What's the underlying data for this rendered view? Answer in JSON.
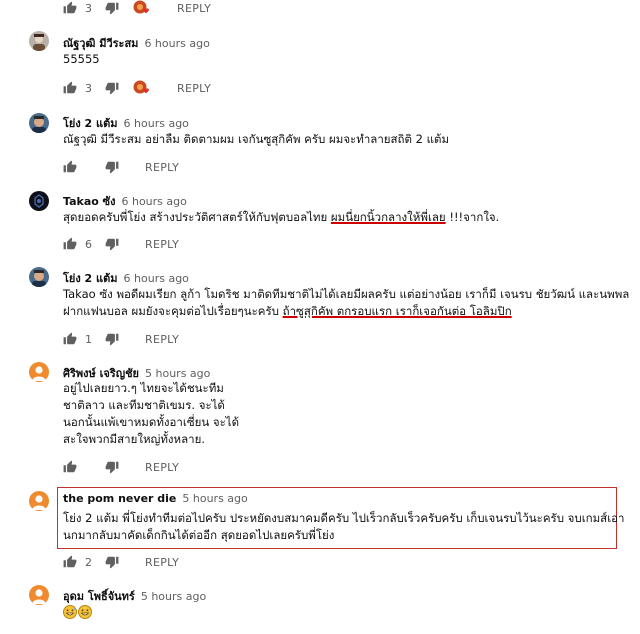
{
  "reply_label": "REPLY",
  "comments": [
    {
      "author": "",
      "time": "",
      "lines": [],
      "likes": "3",
      "creator_heart": true
    },
    {
      "author": "ณัฐวุฒิ มีวีระสม",
      "time": "6 hours ago",
      "lines": [
        "55555"
      ],
      "likes": "3",
      "creator_heart": true
    },
    {
      "author": "โย่ง 2 แต้ม",
      "time": "6 hours ago",
      "lines": [
        "ณัฐวุฒิ มีวีระสม อย่าลืม ติดตามผม เจกันซูสุกิคัพ ครับ ผมจะทำลายสถิติ 2 แต้ม"
      ],
      "likes": "",
      "creator_heart": false
    },
    {
      "author": "Takao ซัง",
      "time": "6 hours ago",
      "line_plain": "สุดยอดครับพี่โย่ง สร้างประวัติศาสตร์ให้กับฟุตบอลไทย ",
      "line_underlined": "ผมนี่ยกนิ้วกลางให้พี่เลย",
      "line_tail": " !!!จากใจ.",
      "likes": "6",
      "creator_heart": false
    },
    {
      "author": "โย่ง 2 แต้ม",
      "time": "6 hours ago",
      "line1": "Takao ซัง พอดีผมเรียก ลูก้า โมดริช มาติดทีมชาติไม่ได้เลยมีผลครับ แต่อย่างน้อย เราก็มี เจนรบ ชัยวัฒน์ และนพพล",
      "line2_plain": "ฝากแฟนบอล ผมยังจะคุมต่อไปเรื่อยๆนะครับ ",
      "line2_underlined": "ถ้าซูสุกิคัพ ตกรอบแรก เราก็เจอกันต่อ โอลิมปิก",
      "likes": "1",
      "creator_heart": false
    },
    {
      "author": "ศิริพงษ์ เจริญชัย",
      "time": "5 hours ago",
      "lines": [
        "อยู่ไปเลยยาว.ๆ ไทยจะได้ชนะทีม",
        "ชาติลาว และทีมชาติเขมร. จะได้",
        "นอกนั้นแพ้เขาหมดทั้งอาเซี่ยน จะได้",
        "สะใจพวกมีสายใหญ่ทั้งหลาย."
      ],
      "likes": "",
      "creator_heart": false
    },
    {
      "author": "the pom never die",
      "time": "5 hours ago",
      "lines": [
        "โย่ง 2 แต้ม พี่โย่งทำทีมต่อไปครับ ประหยัดงบสมาคมดีครับ ไปเร็วกลับเร็วครับครับ เก็บเจนรบไว้นะครับ จบเกมส์เอา",
        "นกมากลับมาคัดเด็กกินได้ต่ออีก สุดยอดไปเลยครับพี่โย่ง"
      ],
      "likes": "2",
      "creator_heart": false
    },
    {
      "author": "อุดม โพธิ์จันทร์",
      "time": "5 hours ago",
      "emojis": [
        "grinning-face-with-sweat",
        "grinning-face-with-sweat"
      ]
    }
  ],
  "colors": {
    "text": "#0f0f0f",
    "meta": "#606060",
    "highlight_border": "#c4302b",
    "heart": "#e52d27"
  }
}
